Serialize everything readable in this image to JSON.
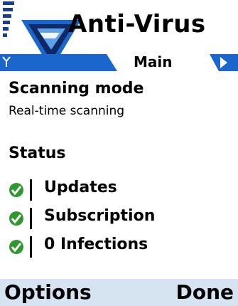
{
  "header": {
    "app_title": "Anti-Virus",
    "tab_label": "Main"
  },
  "scanning": {
    "title": "Scanning mode",
    "value": "Real-time scanning"
  },
  "status": {
    "title": "Status",
    "items": [
      {
        "label": "Updates",
        "state": "ok"
      },
      {
        "label": "Subscription",
        "state": "ok"
      },
      {
        "label": "0 Infections",
        "state": "ok"
      }
    ]
  },
  "softkeys": {
    "left": "Options",
    "right": "Done"
  },
  "colors": {
    "accent": "#1a66cc",
    "check_green": "#2e9a2e"
  }
}
